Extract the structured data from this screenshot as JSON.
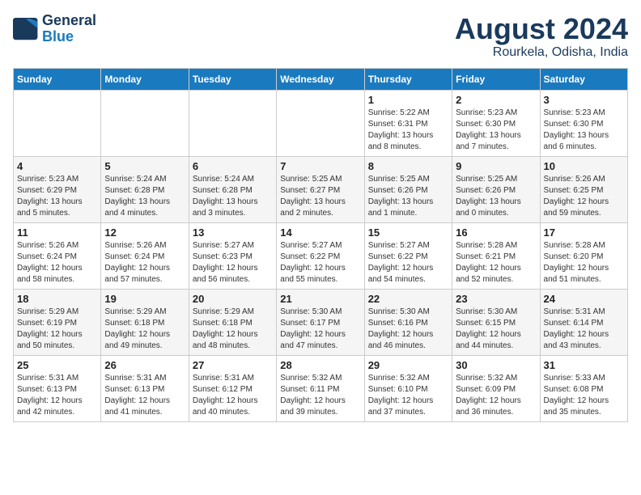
{
  "logo": {
    "line1": "General",
    "line2": "Blue"
  },
  "title": "August 2024",
  "location": "Rourkela, Odisha, India",
  "weekdays": [
    "Sunday",
    "Monday",
    "Tuesday",
    "Wednesday",
    "Thursday",
    "Friday",
    "Saturday"
  ],
  "weeks": [
    [
      {
        "day": "",
        "info": ""
      },
      {
        "day": "",
        "info": ""
      },
      {
        "day": "",
        "info": ""
      },
      {
        "day": "",
        "info": ""
      },
      {
        "day": "1",
        "info": "Sunrise: 5:22 AM\nSunset: 6:31 PM\nDaylight: 13 hours\nand 8 minutes."
      },
      {
        "day": "2",
        "info": "Sunrise: 5:23 AM\nSunset: 6:30 PM\nDaylight: 13 hours\nand 7 minutes."
      },
      {
        "day": "3",
        "info": "Sunrise: 5:23 AM\nSunset: 6:30 PM\nDaylight: 13 hours\nand 6 minutes."
      }
    ],
    [
      {
        "day": "4",
        "info": "Sunrise: 5:23 AM\nSunset: 6:29 PM\nDaylight: 13 hours\nand 5 minutes."
      },
      {
        "day": "5",
        "info": "Sunrise: 5:24 AM\nSunset: 6:28 PM\nDaylight: 13 hours\nand 4 minutes."
      },
      {
        "day": "6",
        "info": "Sunrise: 5:24 AM\nSunset: 6:28 PM\nDaylight: 13 hours\nand 3 minutes."
      },
      {
        "day": "7",
        "info": "Sunrise: 5:25 AM\nSunset: 6:27 PM\nDaylight: 13 hours\nand 2 minutes."
      },
      {
        "day": "8",
        "info": "Sunrise: 5:25 AM\nSunset: 6:26 PM\nDaylight: 13 hours\nand 1 minute."
      },
      {
        "day": "9",
        "info": "Sunrise: 5:25 AM\nSunset: 6:26 PM\nDaylight: 13 hours\nand 0 minutes."
      },
      {
        "day": "10",
        "info": "Sunrise: 5:26 AM\nSunset: 6:25 PM\nDaylight: 12 hours\nand 59 minutes."
      }
    ],
    [
      {
        "day": "11",
        "info": "Sunrise: 5:26 AM\nSunset: 6:24 PM\nDaylight: 12 hours\nand 58 minutes."
      },
      {
        "day": "12",
        "info": "Sunrise: 5:26 AM\nSunset: 6:24 PM\nDaylight: 12 hours\nand 57 minutes."
      },
      {
        "day": "13",
        "info": "Sunrise: 5:27 AM\nSunset: 6:23 PM\nDaylight: 12 hours\nand 56 minutes."
      },
      {
        "day": "14",
        "info": "Sunrise: 5:27 AM\nSunset: 6:22 PM\nDaylight: 12 hours\nand 55 minutes."
      },
      {
        "day": "15",
        "info": "Sunrise: 5:27 AM\nSunset: 6:22 PM\nDaylight: 12 hours\nand 54 minutes."
      },
      {
        "day": "16",
        "info": "Sunrise: 5:28 AM\nSunset: 6:21 PM\nDaylight: 12 hours\nand 52 minutes."
      },
      {
        "day": "17",
        "info": "Sunrise: 5:28 AM\nSunset: 6:20 PM\nDaylight: 12 hours\nand 51 minutes."
      }
    ],
    [
      {
        "day": "18",
        "info": "Sunrise: 5:29 AM\nSunset: 6:19 PM\nDaylight: 12 hours\nand 50 minutes."
      },
      {
        "day": "19",
        "info": "Sunrise: 5:29 AM\nSunset: 6:18 PM\nDaylight: 12 hours\nand 49 minutes."
      },
      {
        "day": "20",
        "info": "Sunrise: 5:29 AM\nSunset: 6:18 PM\nDaylight: 12 hours\nand 48 minutes."
      },
      {
        "day": "21",
        "info": "Sunrise: 5:30 AM\nSunset: 6:17 PM\nDaylight: 12 hours\nand 47 minutes."
      },
      {
        "day": "22",
        "info": "Sunrise: 5:30 AM\nSunset: 6:16 PM\nDaylight: 12 hours\nand 46 minutes."
      },
      {
        "day": "23",
        "info": "Sunrise: 5:30 AM\nSunset: 6:15 PM\nDaylight: 12 hours\nand 44 minutes."
      },
      {
        "day": "24",
        "info": "Sunrise: 5:31 AM\nSunset: 6:14 PM\nDaylight: 12 hours\nand 43 minutes."
      }
    ],
    [
      {
        "day": "25",
        "info": "Sunrise: 5:31 AM\nSunset: 6:13 PM\nDaylight: 12 hours\nand 42 minutes."
      },
      {
        "day": "26",
        "info": "Sunrise: 5:31 AM\nSunset: 6:13 PM\nDaylight: 12 hours\nand 41 minutes."
      },
      {
        "day": "27",
        "info": "Sunrise: 5:31 AM\nSunset: 6:12 PM\nDaylight: 12 hours\nand 40 minutes."
      },
      {
        "day": "28",
        "info": "Sunrise: 5:32 AM\nSunset: 6:11 PM\nDaylight: 12 hours\nand 39 minutes."
      },
      {
        "day": "29",
        "info": "Sunrise: 5:32 AM\nSunset: 6:10 PM\nDaylight: 12 hours\nand 37 minutes."
      },
      {
        "day": "30",
        "info": "Sunrise: 5:32 AM\nSunset: 6:09 PM\nDaylight: 12 hours\nand 36 minutes."
      },
      {
        "day": "31",
        "info": "Sunrise: 5:33 AM\nSunset: 6:08 PM\nDaylight: 12 hours\nand 35 minutes."
      }
    ]
  ]
}
